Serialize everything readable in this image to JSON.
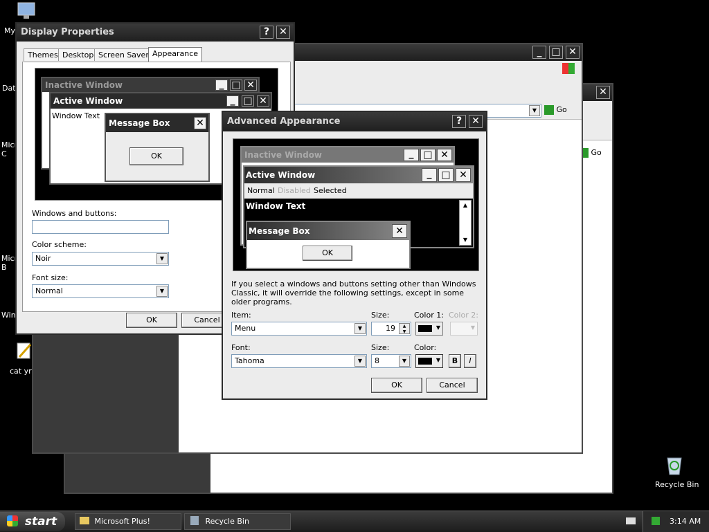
{
  "desktop": {
    "icons": [
      {
        "label": "My"
      },
      {
        "label": "Dat"
      },
      {
        "label": "Micro C"
      },
      {
        "label": "Micro B"
      },
      {
        "label": "Winc"
      },
      {
        "label": "cat yrf"
      },
      {
        "label": "Recycle Bin"
      }
    ]
  },
  "explorer": {
    "go_label": "Go",
    "go_label2": "Go"
  },
  "display_properties": {
    "title": "Display Properties",
    "tabs": [
      "Themes",
      "Desktop",
      "Screen Saver",
      "Appearance"
    ],
    "preview": {
      "inactive_title": "Inactive Window",
      "active_title": "Active Window",
      "window_text": "Window Text",
      "msgbox_title": "Message Box",
      "ok": "OK"
    },
    "windows_buttons_label": "Windows and buttons:",
    "windows_buttons_value": "",
    "color_scheme_label": "Color scheme:",
    "color_scheme_value": "Noir",
    "font_size_label": "Font size:",
    "font_size_value": "Normal",
    "ok": "OK",
    "cancel": "Cancel"
  },
  "advanced": {
    "title": "Advanced Appearance",
    "preview": {
      "inactive_title": "Inactive Window",
      "active_title": "Active Window",
      "menu_normal": "Normal",
      "menu_disabled": "Disabled",
      "menu_selected": "Selected",
      "window_text": "Window Text",
      "msgbox_title": "Message Box",
      "ok": "OK"
    },
    "info": "If you select a windows and buttons setting other than Windows Classic, it will override the following settings, except in some older programs.",
    "item_label": "Item:",
    "item_value": "Menu",
    "size_label": "Size:",
    "size_value": "19",
    "color1_label": "Color 1:",
    "color2_label": "Color 2:",
    "font_label": "Font:",
    "font_value": "Tahoma",
    "font_size_label": "Size:",
    "font_size_value": "8",
    "color_label": "Color:",
    "bold": "B",
    "italic": "I",
    "ok": "OK",
    "cancel": "Cancel"
  },
  "taskbar": {
    "start": "start",
    "items": [
      "Microsoft Plus!",
      "Recycle Bin"
    ],
    "time": "3:14 AM"
  },
  "colors": {
    "accent": "#2b2b2b",
    "dialog_bg": "#ececec",
    "desktop": "#000000"
  }
}
